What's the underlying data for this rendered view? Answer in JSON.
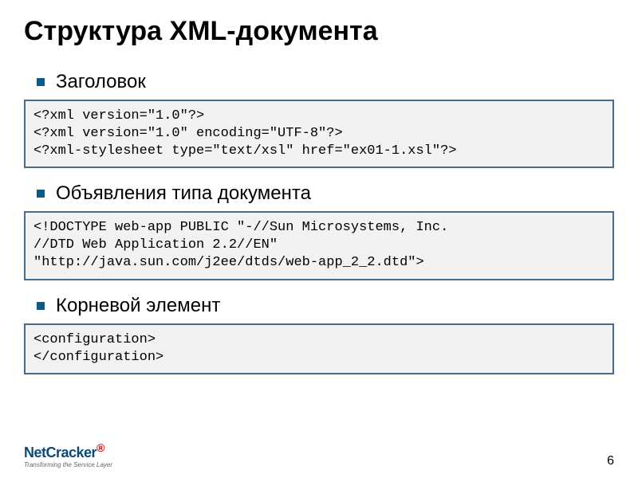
{
  "title": "Структура XML-документа",
  "sections": [
    {
      "heading": "Заголовок",
      "code": "<?xml version=\"1.0\"?>\n<?xml version=\"1.0\" encoding=\"UTF-8\"?>\n<?xml-stylesheet type=\"text/xsl\" href=\"ex01-1.xsl\"?>"
    },
    {
      "heading": "Объявления типа документа",
      "code": "<!DOCTYPE web-app PUBLIC \"-//Sun Microsystems, Inc.\n//DTD Web Application 2.2//EN\"\n\"http://java.sun.com/j2ee/dtds/web-app_2_2.dtd\">"
    },
    {
      "heading": "Корневой элемент",
      "code": "<configuration>\n</configuration>"
    }
  ],
  "footer": {
    "logo_main": "NetCracker",
    "logo_reg": "®",
    "logo_sub": "Transforming the Service Layer",
    "page": "6"
  }
}
